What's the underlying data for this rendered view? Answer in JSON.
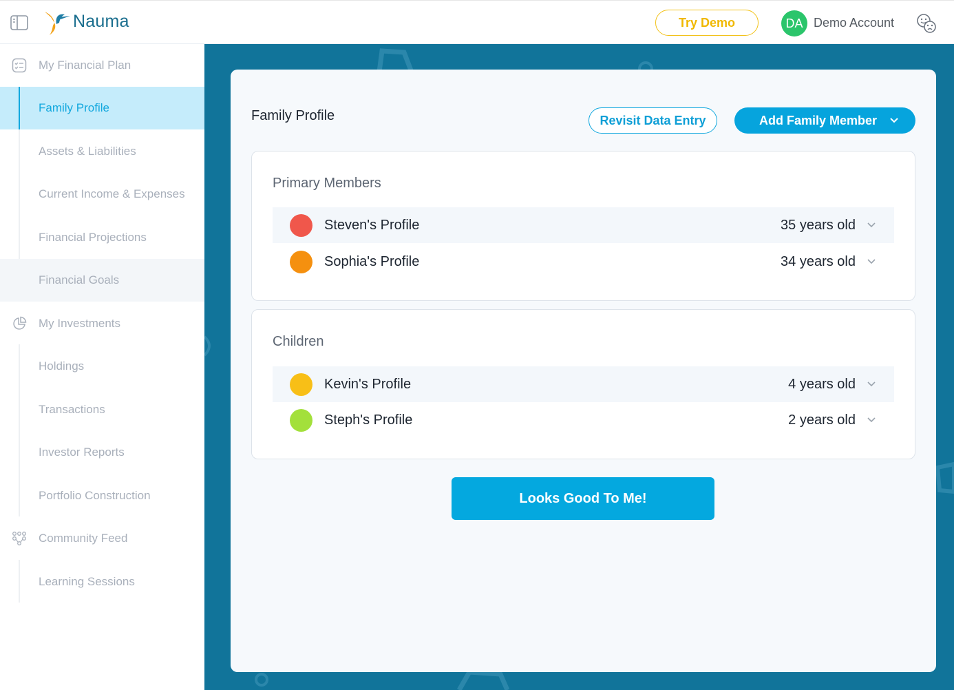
{
  "header": {
    "brand": "Nauma",
    "try_demo_label": "Try Demo",
    "avatar_initials": "DA",
    "account_name": "Demo Account",
    "colors": {
      "accent": "#12a8de",
      "try_demo": "#f0b800",
      "avatar": "#2bc56b"
    }
  },
  "sidebar": {
    "items": [
      {
        "label": "My Financial Plan",
        "icon": "checklist-icon"
      },
      {
        "label": "Family Profile"
      },
      {
        "label": "Assets & Liabilities"
      },
      {
        "label": "Current Income & Expenses"
      },
      {
        "label": "Financial Projections"
      },
      {
        "label": "Financial Goals"
      },
      {
        "label": "My Investments",
        "icon": "pie-chart-icon"
      },
      {
        "label": "Holdings"
      },
      {
        "label": "Transactions"
      },
      {
        "label": "Investor Reports"
      },
      {
        "label": "Portfolio Construction"
      },
      {
        "label": "Community Feed",
        "icon": "community-icon"
      },
      {
        "label": "Learning Sessions"
      }
    ],
    "active": "Family Profile"
  },
  "main": {
    "title": "Family Profile",
    "revisit_label": "Revisit Data Entry",
    "add_member_label": "Add Family Member",
    "primary": {
      "title": "Primary Members",
      "members": [
        {
          "name": "Steven's Profile",
          "age": "35 years old",
          "color": "#f0574b"
        },
        {
          "name": "Sophia's Profile",
          "age": "34 years old",
          "color": "#f5900f"
        }
      ]
    },
    "children": {
      "title": "Children",
      "members": [
        {
          "name": "Kevin's Profile",
          "age": "4 years old",
          "color": "#f8bf17"
        },
        {
          "name": "Steph's Profile",
          "age": "2 years old",
          "color": "#a3e03b"
        }
      ]
    },
    "confirm_label": "Looks Good To Me!"
  }
}
